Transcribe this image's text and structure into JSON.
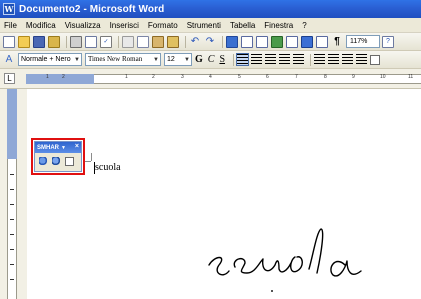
{
  "window": {
    "title": "Documento2 - Microsoft Word",
    "app_icon_letter": "W"
  },
  "menu": [
    {
      "label": "File"
    },
    {
      "label": "Modifica"
    },
    {
      "label": "Visualizza"
    },
    {
      "label": "Inserisci"
    },
    {
      "label": "Formato"
    },
    {
      "label": "Strumenti"
    },
    {
      "label": "Tabella"
    },
    {
      "label": "Finestra"
    },
    {
      "label": "?"
    }
  ],
  "standard_toolbar": {
    "zoom": "117%",
    "pilcrow": "¶"
  },
  "formatting_toolbar": {
    "style": "Normale + Nero",
    "font": "Times New Roman",
    "size": "12",
    "bold": "G",
    "italic": "C",
    "underline": "S"
  },
  "ruler": {
    "tab_selector": "L",
    "numbers": [
      "1",
      "2",
      "1",
      "2",
      "3",
      "4",
      "5",
      "6",
      "7",
      "8",
      "9",
      "10",
      "11"
    ]
  },
  "smhar_toolbar": {
    "title": "SMHAR",
    "title_arrow": "▼",
    "close": "×",
    "highlight_color": "#e01010"
  },
  "document": {
    "text": "scuola",
    "handwriting": "scuola"
  },
  "colors": {
    "titlebar": "#2a5fd3",
    "chrome": "#ece9d8",
    "ruler_margin": "#8fa8d6"
  }
}
